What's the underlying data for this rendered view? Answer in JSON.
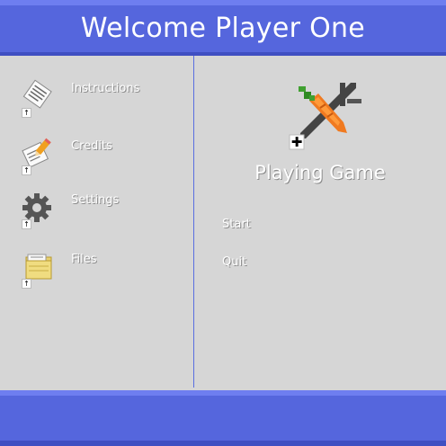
{
  "header": {
    "title": "Welcome Player One"
  },
  "sidebar": {
    "items": [
      {
        "label": "Instructions",
        "icon": "notepad-icon"
      },
      {
        "label": "Credits",
        "icon": "pencil-paper-icon"
      },
      {
        "label": "Settings",
        "icon": "gear-icon"
      },
      {
        "label": "Files",
        "icon": "folder-icon"
      }
    ]
  },
  "main": {
    "game_icon": "carrot-sword-icon",
    "title": "Playing Game",
    "actions": [
      {
        "label": "Start"
      },
      {
        "label": "Quit"
      }
    ]
  },
  "colors": {
    "header": "#5566dd",
    "background": "#d6d6d6",
    "divider": "#5a6ee0"
  }
}
